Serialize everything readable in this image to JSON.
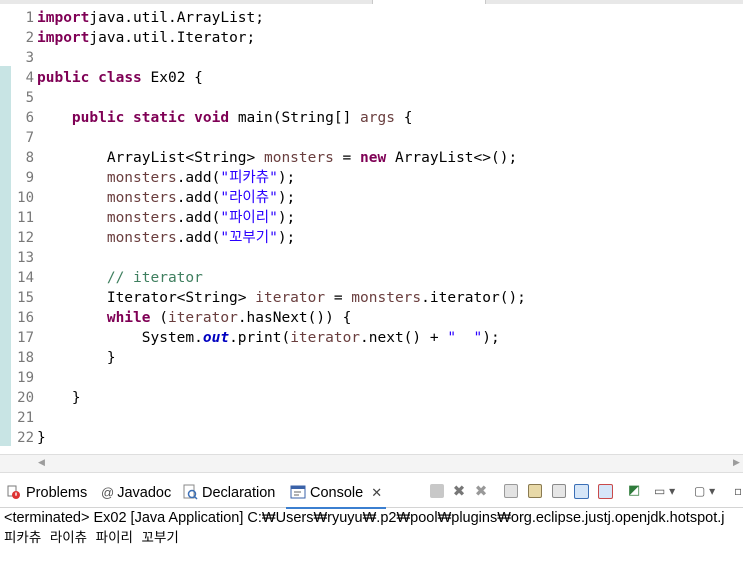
{
  "editor": {
    "lines": [
      {
        "n": "1",
        "segs": [
          [
            "kw",
            "import"
          ],
          [
            "",
            "java.util.ArrayList;"
          ]
        ]
      },
      {
        "n": "2",
        "segs": [
          [
            "kw",
            "import"
          ],
          [
            "",
            "java.util.Iterator;"
          ]
        ]
      },
      {
        "n": "3",
        "segs": []
      },
      {
        "n": "4",
        "segs": [
          [
            "kw",
            "public"
          ],
          [
            "",
            " "
          ],
          [
            "kw",
            "class"
          ],
          [
            "",
            " Ex02 {"
          ]
        ]
      },
      {
        "n": "5",
        "segs": []
      },
      {
        "n": "6",
        "segs": [
          [
            "",
            "    "
          ],
          [
            "kw",
            "public"
          ],
          [
            "",
            " "
          ],
          [
            "kw",
            "static"
          ],
          [
            "",
            " "
          ],
          [
            "kw",
            "void"
          ],
          [
            "",
            " main(String[] "
          ],
          [
            "var",
            "args"
          ],
          [
            "",
            " {"
          ]
        ]
      },
      {
        "n": "7",
        "segs": []
      },
      {
        "n": "8",
        "segs": [
          [
            "",
            "        ArrayList<String> "
          ],
          [
            "var",
            "monsters"
          ],
          [
            "",
            " = "
          ],
          [
            "kw",
            "new"
          ],
          [
            "",
            " ArrayList<>();"
          ]
        ]
      },
      {
        "n": "9",
        "segs": [
          [
            "",
            "        "
          ],
          [
            "var",
            "monsters"
          ],
          [
            "",
            ".add("
          ],
          [
            "str",
            "\"피카츄\""
          ],
          [
            "",
            ");"
          ]
        ]
      },
      {
        "n": "10",
        "segs": [
          [
            "",
            "        "
          ],
          [
            "var",
            "monsters"
          ],
          [
            "",
            ".add("
          ],
          [
            "str",
            "\"라이츄\""
          ],
          [
            "",
            ");"
          ]
        ]
      },
      {
        "n": "11",
        "segs": [
          [
            "",
            "        "
          ],
          [
            "var",
            "monsters"
          ],
          [
            "",
            ".add("
          ],
          [
            "str",
            "\"파이리\""
          ],
          [
            "",
            ");"
          ]
        ]
      },
      {
        "n": "12",
        "segs": [
          [
            "",
            "        "
          ],
          [
            "var",
            "monsters"
          ],
          [
            "",
            ".add("
          ],
          [
            "str",
            "\"꼬부기\""
          ],
          [
            "",
            ");"
          ]
        ]
      },
      {
        "n": "13",
        "segs": []
      },
      {
        "n": "14",
        "segs": [
          [
            "",
            "        "
          ],
          [
            "cmt",
            "// iterator"
          ]
        ]
      },
      {
        "n": "15",
        "segs": [
          [
            "",
            "        Iterator<String> "
          ],
          [
            "var",
            "iterator"
          ],
          [
            "",
            " = "
          ],
          [
            "var",
            "monsters"
          ],
          [
            "",
            ".iterator();"
          ]
        ]
      },
      {
        "n": "16",
        "segs": [
          [
            "",
            "        "
          ],
          [
            "kw",
            "while"
          ],
          [
            "",
            " ("
          ],
          [
            "var",
            "iterator"
          ],
          [
            "",
            ".hasNext()) {"
          ]
        ]
      },
      {
        "n": "17",
        "segs": [
          [
            "",
            "            System."
          ],
          [
            "fld",
            "out"
          ],
          [
            "",
            ".print("
          ],
          [
            "var",
            "iterator"
          ],
          [
            "",
            ".next() + "
          ],
          [
            "str",
            "\"  \""
          ],
          [
            "",
            ");"
          ]
        ]
      },
      {
        "n": "18",
        "segs": [
          [
            "",
            "        }"
          ]
        ]
      },
      {
        "n": "19",
        "segs": []
      },
      {
        "n": "20",
        "segs": [
          [
            "",
            "    }"
          ]
        ]
      },
      {
        "n": "21",
        "segs": []
      },
      {
        "n": "22",
        "segs": [
          [
            "",
            "}"
          ]
        ]
      }
    ]
  },
  "views": {
    "problems": "Problems",
    "javadoc": "Javadoc",
    "declaration": "Declaration",
    "console": "Console",
    "close": "✕"
  },
  "console": {
    "status": "<terminated> Ex02 [Java Application] C:₩Users₩ryuyu₩.p2₩pool₩plugins₩org.eclipse.justj.openjdk.hotspot.j",
    "output": "피카츄  라이츄  파이리  꼬부기"
  },
  "colors": {
    "keyword": "#7f0055",
    "variable": "#6a3e3e",
    "string": "#2a00ff",
    "comment": "#3f7f5f",
    "field": "#0000c0",
    "accent": "#3b7fd0"
  },
  "icons": [
    "problems-icon",
    "javadoc-icon",
    "declaration-icon",
    "console-icon",
    "terminate-icon",
    "remove-launch-icon",
    "remove-all-icon",
    "clear-console-icon",
    "scroll-lock-icon",
    "word-wrap-icon",
    "pin-console-icon",
    "display-console-icon",
    "open-console-icon",
    "view-menu-icon"
  ]
}
